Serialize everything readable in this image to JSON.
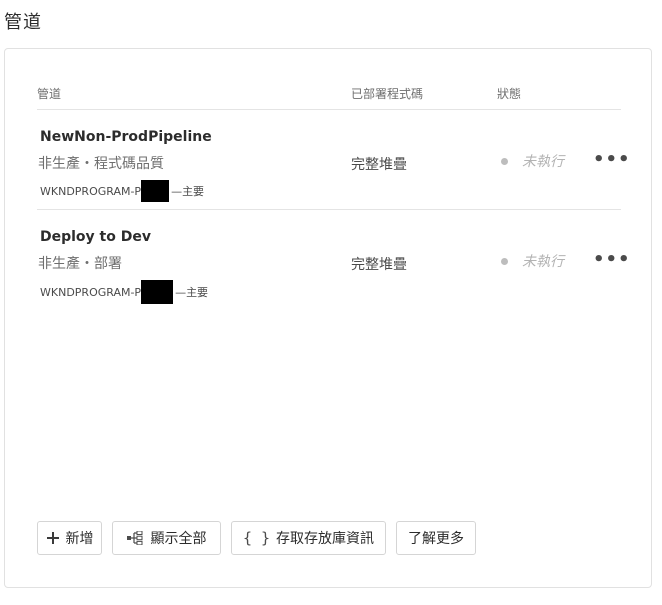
{
  "page": {
    "title": "管道"
  },
  "table": {
    "headers": {
      "name": "管道",
      "code": "已部署程式碼",
      "status": "狀態"
    },
    "rows": [
      {
        "name": "NewNon-ProdPipeline",
        "subtitle": "非生產・程式碼品質",
        "repo_prefix": "WKNDPROGRAM-P",
        "repo_suffix": "—主要",
        "code": "完整堆疊",
        "status": "未執行",
        "more": "•••"
      },
      {
        "name": "Deploy to Dev",
        "subtitle": "非生產・部署",
        "repo_prefix": "WKNDPROGRAM-P",
        "repo_suffix": "—主要",
        "code": "完整堆疊",
        "status": "未執行",
        "more": "•••"
      }
    ]
  },
  "footer": {
    "add_label": "新增",
    "show_all_label": "顯示全部",
    "repo_info_label": "存取存放庫資訊",
    "learn_more_label": "了解更多"
  },
  "icons": {
    "add": "plus-icon",
    "show_all": "pipeline-tree-icon",
    "repo_info": "braces-icon",
    "more": "ellipsis-icon",
    "status": "status-dot-icon"
  },
  "colors": {
    "status_dot": "#bdbdbd",
    "status_text": "#b3b3b3",
    "border": "#e1e1e1",
    "text": "#2c2c2c"
  }
}
